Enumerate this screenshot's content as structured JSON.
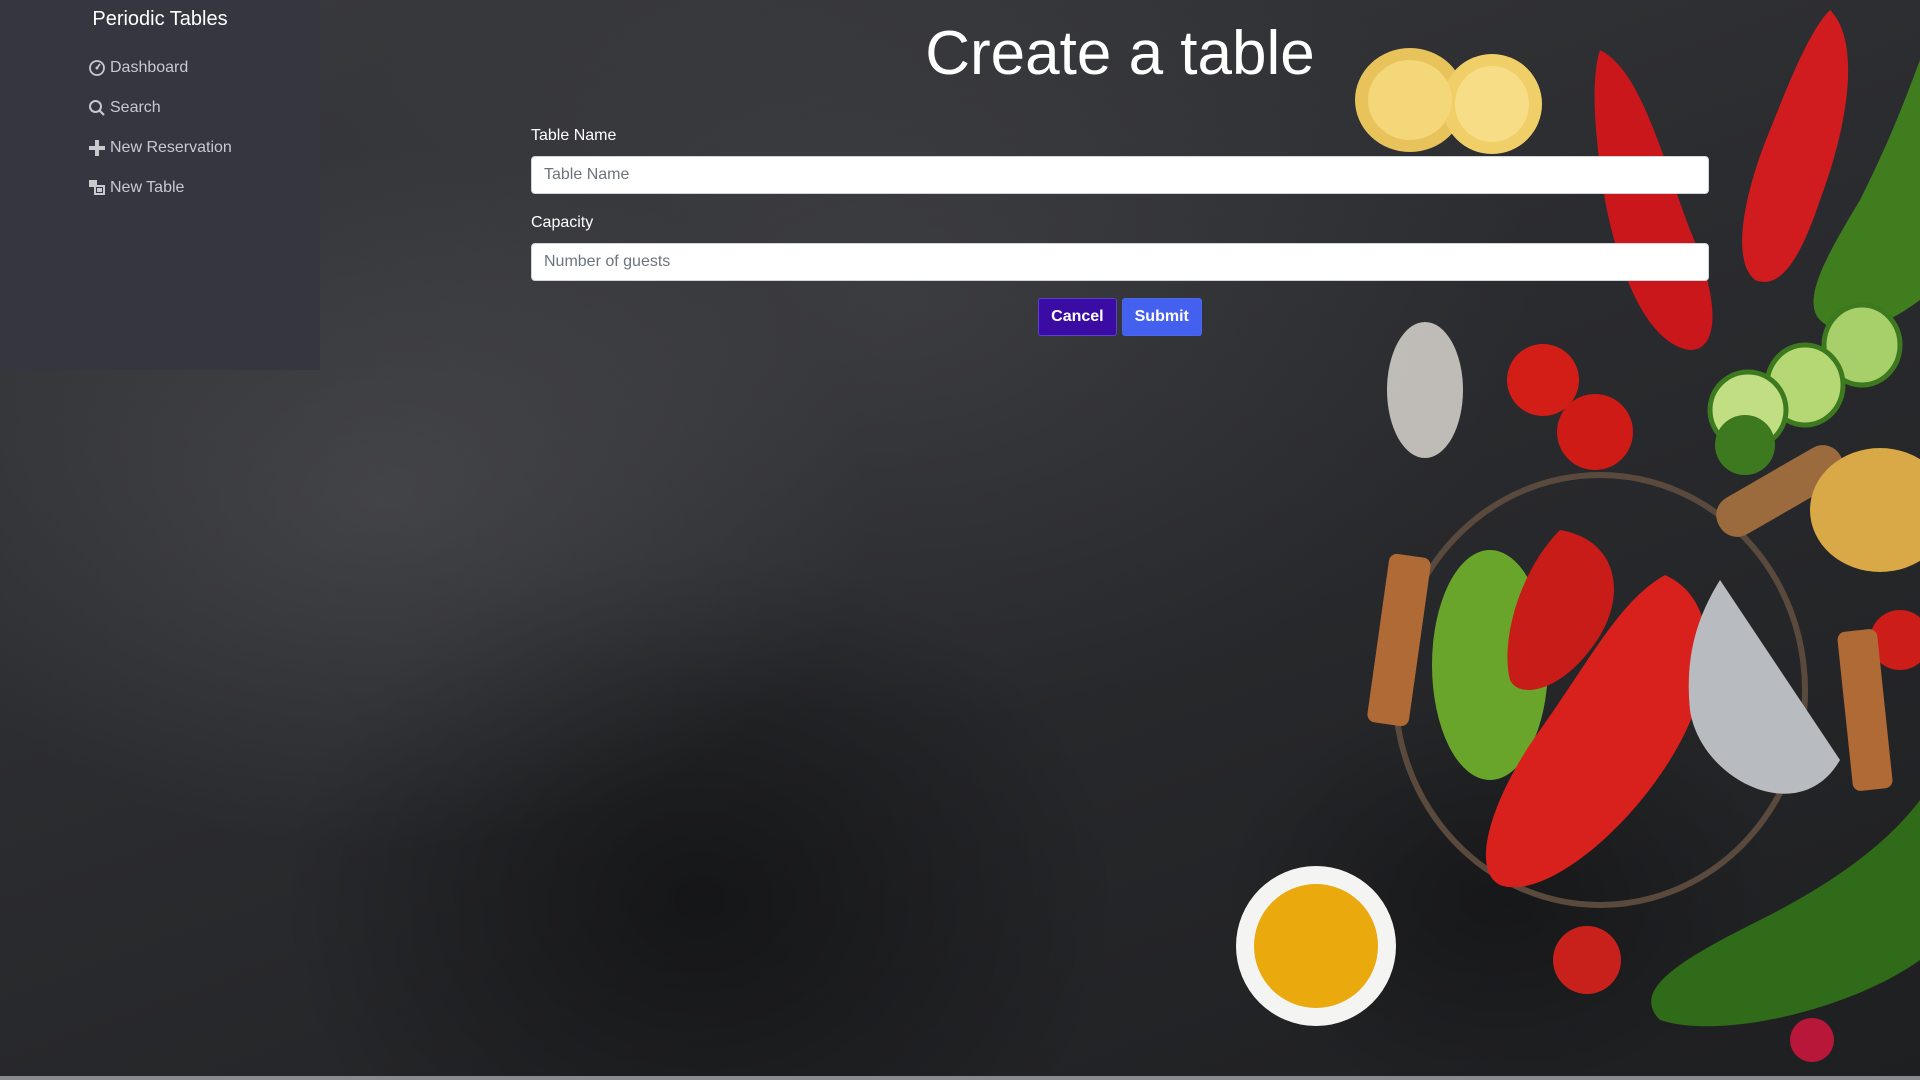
{
  "sidebar": {
    "brand": "Periodic Tables",
    "items": [
      {
        "label": "Dashboard",
        "icon": "dashboard-icon"
      },
      {
        "label": "Search",
        "icon": "search-icon"
      },
      {
        "label": "New Reservation",
        "icon": "plus-icon"
      },
      {
        "label": "New Table",
        "icon": "new-table-icon"
      }
    ]
  },
  "main": {
    "title": "Create a table",
    "fields": {
      "table_name": {
        "label": "Table Name",
        "placeholder": "Table Name",
        "value": ""
      },
      "capacity": {
        "label": "Capacity",
        "placeholder": "Number of guests",
        "value": ""
      }
    },
    "buttons": {
      "cancel": "Cancel",
      "submit": "Submit"
    }
  },
  "colors": {
    "sidebar_bg": "#353640",
    "cancel_bg": "#3a0ca3",
    "submit_bg": "#4361ee"
  }
}
